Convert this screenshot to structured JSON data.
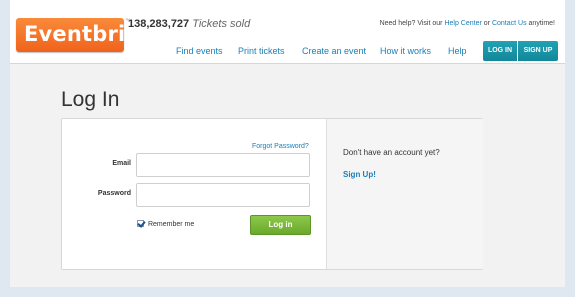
{
  "header": {
    "logo_text": "Eventbrite",
    "tm": "™",
    "tickets_count": "138,283,727",
    "tickets_text": "Tickets sold",
    "help_prefix": "Need help? Visit our",
    "help_center": "Help Center",
    "help_or": "or",
    "contact_us": "Contact Us",
    "help_suffix": "anytime!",
    "nav": [
      "Find events",
      "Print tickets",
      "Create an event",
      "How it works",
      "Help"
    ],
    "login_button": "LOG IN",
    "signup_button": "SIGN UP"
  },
  "main": {
    "title": "Log In",
    "forgot_password": "Forgot Password?",
    "email_label": "Email",
    "email_value": "",
    "password_label": "Password",
    "password_value": "",
    "remember_me": "Remember me",
    "remember_checked": true,
    "login_button": "Log in",
    "no_account": "Don't have an account yet?",
    "signup_link": "Sign Up!"
  },
  "colors": {
    "brand_orange": "#f0631d",
    "link_blue": "#1a7fb8",
    "teal_button": "#13879a",
    "green_button": "#6aa82c"
  }
}
